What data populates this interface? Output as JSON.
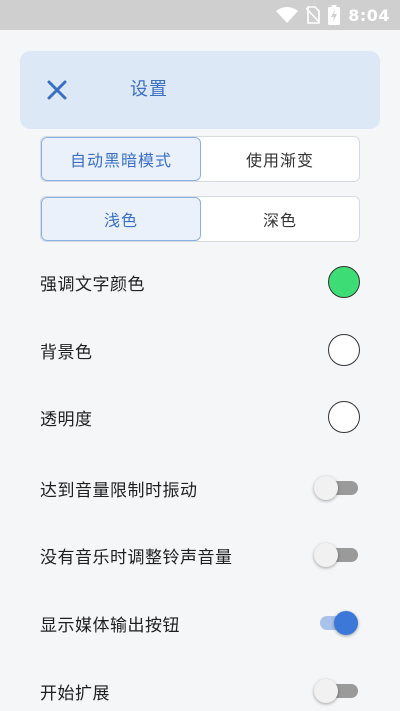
{
  "status_bar": {
    "time": "8:04"
  },
  "header": {
    "title": "设置"
  },
  "mode_segment": {
    "options": [
      "自动黑暗模式",
      "使用渐变"
    ],
    "selected": 0
  },
  "theme_segment": {
    "options": [
      "浅色",
      "深色"
    ],
    "selected": 0
  },
  "color_settings": [
    {
      "label": "强调文字颜色",
      "color": "#3ddc74"
    },
    {
      "label": "背景色",
      "color": "#ffffff"
    },
    {
      "label": "透明度",
      "color": "#ffffff"
    }
  ],
  "toggle_settings": [
    {
      "label": "达到音量限制时振动",
      "on": false
    },
    {
      "label": "没有音乐时调整铃声音量",
      "on": false
    },
    {
      "label": "显示媒体输出按钮",
      "on": true
    },
    {
      "label": "开始扩展",
      "on": false
    }
  ],
  "colors": {
    "accent": "#3a6fc4",
    "header_bg": "#dde8f7"
  }
}
